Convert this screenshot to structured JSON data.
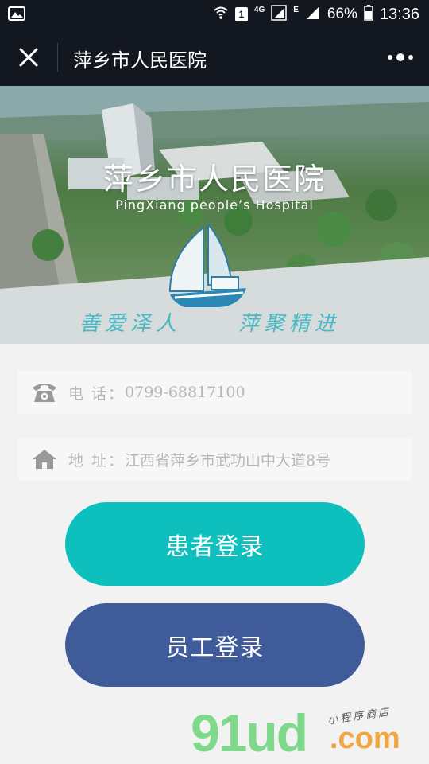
{
  "status_bar": {
    "sim_slot": "1",
    "network_type": "4G",
    "data_indicator": "E",
    "battery_percent": "66%",
    "time": "13:36",
    "icons": [
      "gallery-icon",
      "wifi-icon",
      "signal-icon",
      "battery-icon"
    ]
  },
  "nav": {
    "title": "萍乡市人民医院",
    "close_icon": "close-icon",
    "more_icon": "more-icon"
  },
  "banner": {
    "title": "萍乡市人民医院",
    "subtitle": "PingXiang people’s Hospital",
    "slogan_left": "善爱泽人",
    "slogan_right": "萍聚精进"
  },
  "contact": {
    "phone_label": "电  话：",
    "phone_value": "0799-68817100",
    "address_label": "地  址：",
    "address_value": "江西省萍乡市武功山中大道8号"
  },
  "buttons": {
    "patient_login": "患者登录",
    "staff_login": "员工登录"
  },
  "colors": {
    "patient_button": "#0dbfbd",
    "staff_button": "#3f5b9a",
    "nav_background": "#121720",
    "slogan": "#47b8c6"
  },
  "watermark": {
    "main": "91ud",
    "suffix": ".com",
    "tagline": "小程序商店"
  }
}
